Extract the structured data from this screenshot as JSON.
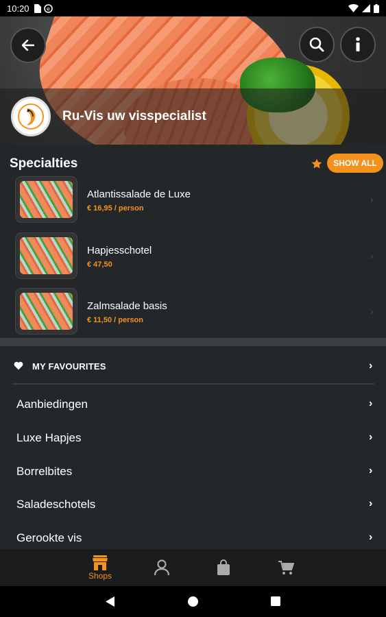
{
  "status_bar": {
    "time": "10:20"
  },
  "header": {
    "shop_name": "Ru-Vis uw visspecialist",
    "back_icon": "arrow-left-icon",
    "search_icon": "search-icon",
    "info_icon": "info-icon"
  },
  "specialties": {
    "title": "Specialties",
    "show_all_label": "SHOW ALL",
    "items": [
      {
        "name": "Atlantissalade de Luxe",
        "price": "€ 16,95 / person"
      },
      {
        "name": "Hapjesschotel",
        "price": "€ 47,50"
      },
      {
        "name": "Zalmsalade basis",
        "price": "€ 11,50 / person"
      }
    ]
  },
  "favourites": {
    "label": "MY FAVOURITES"
  },
  "categories": [
    {
      "label": "Aanbiedingen"
    },
    {
      "label": "Luxe Hapjes"
    },
    {
      "label": "Borrelbites"
    },
    {
      "label": "Saladeschotels"
    },
    {
      "label": "Gerookte vis"
    }
  ],
  "bottom_nav": {
    "items": [
      {
        "label": "Shops",
        "icon": "shop-icon",
        "active": true
      },
      {
        "label": "",
        "icon": "user-icon",
        "active": false
      },
      {
        "label": "",
        "icon": "bag-icon",
        "active": false
      },
      {
        "label": "",
        "icon": "cart-icon",
        "active": false
      }
    ]
  },
  "colors": {
    "accent": "#f5921e",
    "background": "#24272a",
    "nav_background": "#1a1c1e"
  }
}
